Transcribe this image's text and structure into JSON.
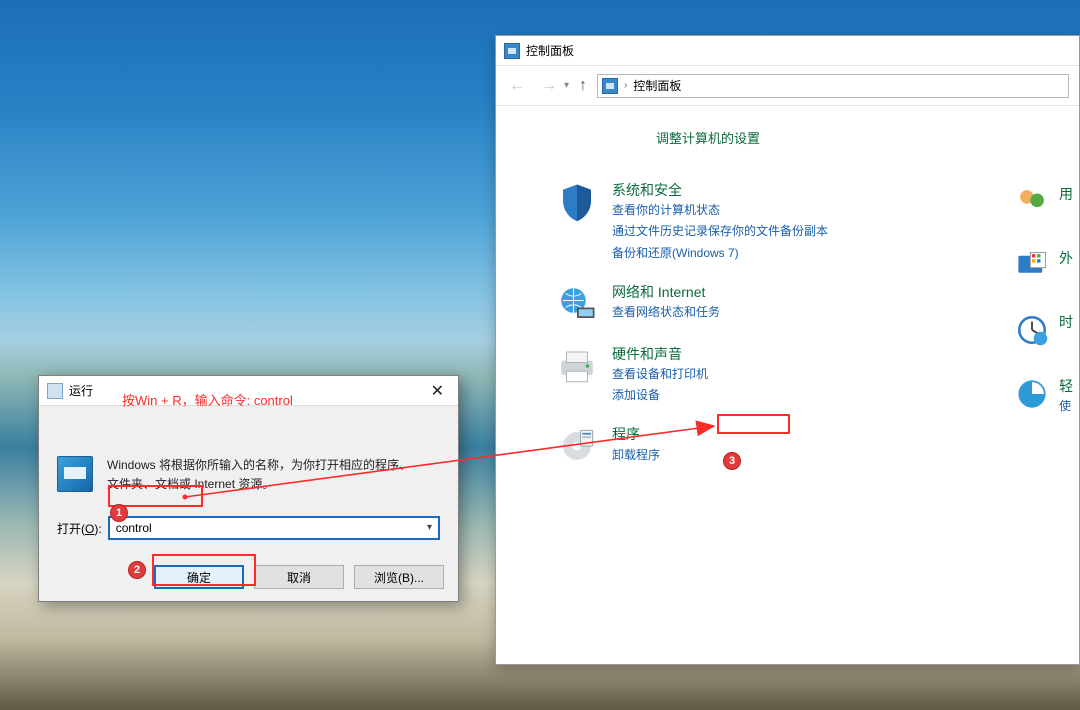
{
  "controlPanel": {
    "title": "控制面板",
    "breadcrumb": "控制面板",
    "heading": "调整计算机的设置",
    "categories": [
      {
        "title": "系统和安全",
        "links": [
          "查看你的计算机状态",
          "通过文件历史记录保存你的文件备份副本",
          "备份和还原(Windows 7)"
        ]
      },
      {
        "title": "网络和 Internet",
        "links": [
          "查看网络状态和任务"
        ]
      },
      {
        "title": "硬件和声音",
        "links": [
          "查看设备和打印机",
          "添加设备"
        ]
      },
      {
        "title": "程序",
        "links": [
          "卸载程序"
        ]
      }
    ],
    "rightColumn": [
      {
        "title": "用",
        "icon": "users-icon"
      },
      {
        "title": "外",
        "icon": "appearance-icon"
      },
      {
        "title": "时",
        "icon": "clock-icon"
      },
      {
        "title": "轻",
        "sub": "使",
        "icon": "ease-icon"
      }
    ]
  },
  "runDialog": {
    "title": "运行",
    "hint": "按Win + R，输入命令: control",
    "description": "Windows 将根据你所输入的名称，为你打开相应的程序、文件夹、文档或 Internet 资源。",
    "openLabelPrefix": "打开(",
    "openLabelKey": "O",
    "openLabelSuffix": "):",
    "inputValue": "control",
    "buttons": {
      "ok": "确定",
      "cancel": "取消",
      "browse": "浏览(B)..."
    }
  },
  "annotations": {
    "step1": "1",
    "step2": "2",
    "step3": "3"
  }
}
